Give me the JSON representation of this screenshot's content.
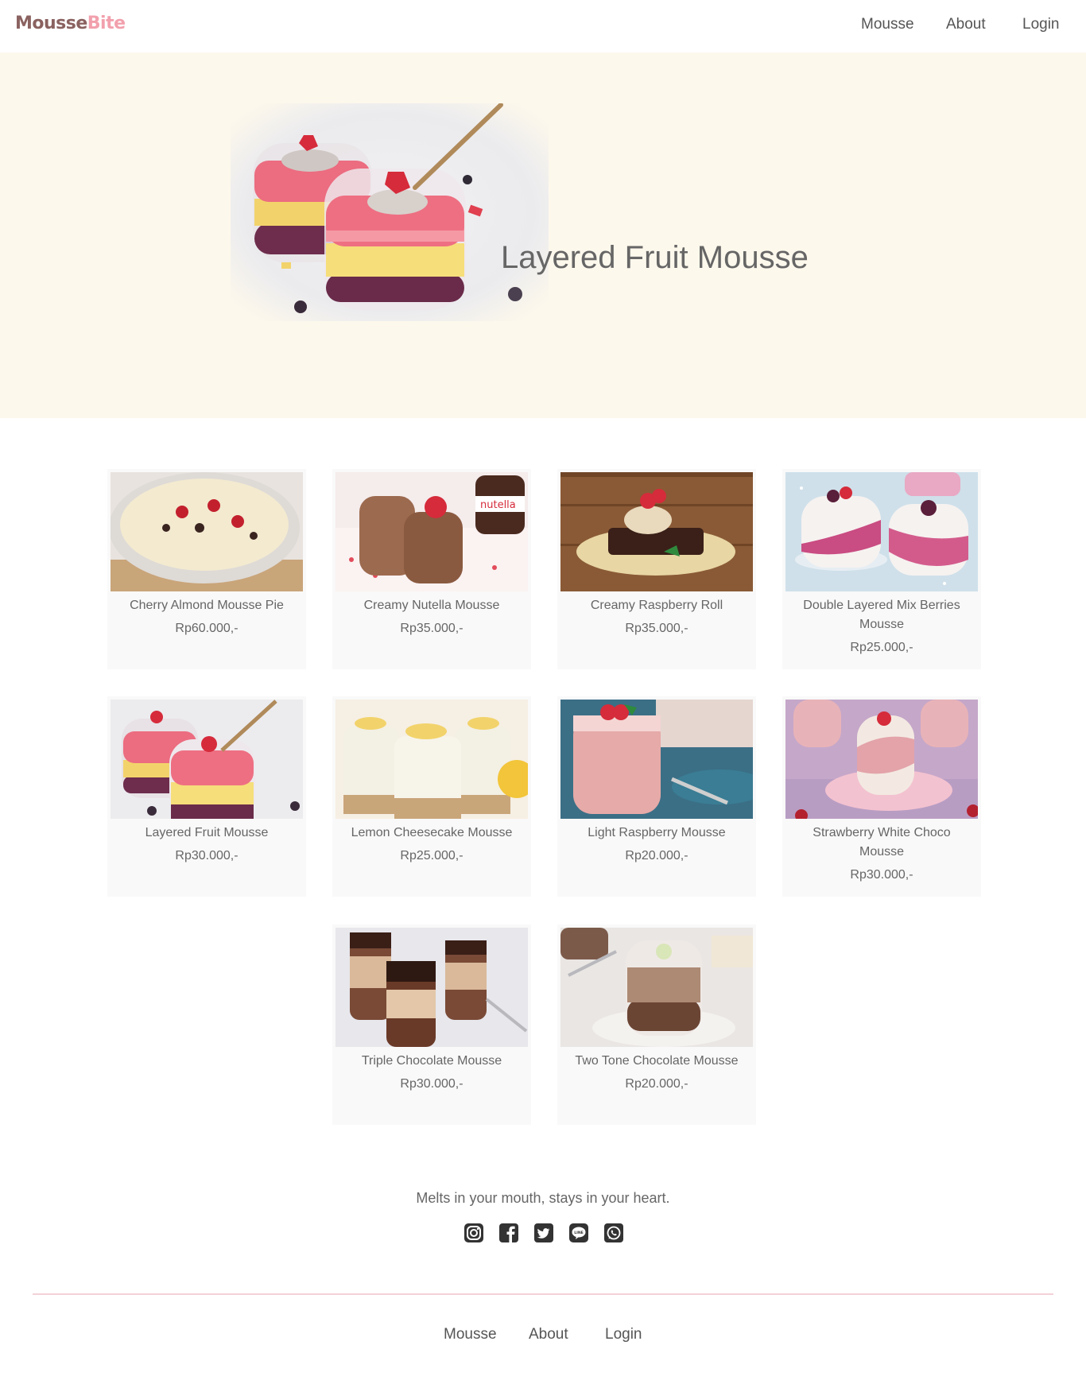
{
  "brand": {
    "part1": "Mousse",
    "part2": "Bite"
  },
  "nav": {
    "mousse": "Mousse",
    "about": "About",
    "login": "Login"
  },
  "hero": {
    "title": "Layered Fruit Mousse"
  },
  "products": [
    {
      "name": "Cherry Almond Mousse Pie",
      "price": "Rp60.000,-"
    },
    {
      "name": "Creamy Nutella Mousse",
      "price": "Rp35.000,-"
    },
    {
      "name": "Creamy Raspberry Roll",
      "price": "Rp35.000,-"
    },
    {
      "name": "Double Layered Mix Berries Mousse",
      "price": "Rp25.000,-"
    },
    {
      "name": "Layered Fruit Mousse",
      "price": "Rp30.000,-"
    },
    {
      "name": "Lemon Cheesecake Mousse",
      "price": "Rp25.000,-"
    },
    {
      "name": "Light Raspberry Mousse",
      "price": "Rp20.000,-"
    },
    {
      "name": "Strawberry White Choco Mousse",
      "price": "Rp30.000,-"
    },
    {
      "name": "Triple Chocolate Mousse",
      "price": "Rp30.000,-"
    },
    {
      "name": "Two Tone Chocolate Mousse",
      "price": "Rp20.000,-"
    }
  ],
  "footer": {
    "tagline": "Melts in your mouth, stays in your heart.",
    "socials": [
      "instagram-icon",
      "facebook-icon",
      "twitter-icon",
      "line-icon",
      "whatsapp-icon"
    ],
    "nav": {
      "mousse": "Mousse",
      "about": "About",
      "login": "Login"
    }
  },
  "colors": {
    "hero_bg": "#fdf8ec",
    "logo_dark": "#8a6260",
    "logo_pink": "#f2a0ad",
    "divider": "#f3d2d8"
  }
}
